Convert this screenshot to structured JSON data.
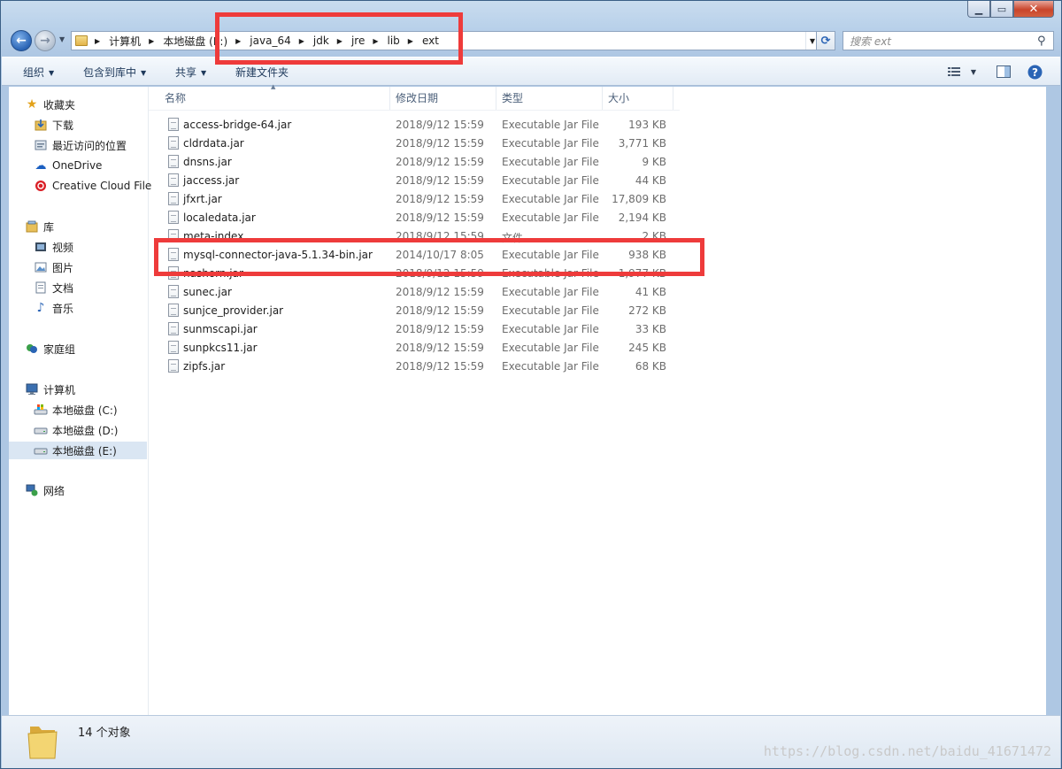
{
  "address": {
    "crumbs": [
      "计算机",
      "本地磁盘 (E:)",
      "java_64",
      "jdk",
      "jre",
      "lib",
      "ext"
    ]
  },
  "search": {
    "placeholder": "搜索 ext"
  },
  "toolbar": {
    "organize": "组织",
    "include_in_library": "包含到库中",
    "share": "共享",
    "new_folder": "新建文件夹"
  },
  "nav": {
    "favorites": "收藏夹",
    "downloads": "下载",
    "recent": "最近访问的位置",
    "onedrive": "OneDrive",
    "creative_cloud": "Creative Cloud File",
    "libraries": "库",
    "videos": "视频",
    "pictures": "图片",
    "documents": "文档",
    "music": "音乐",
    "homegroup": "家庭组",
    "computer": "计算机",
    "drive_c": "本地磁盘 (C:)",
    "drive_d": "本地磁盘 (D:)",
    "drive_e": "本地磁盘 (E:)",
    "network": "网络"
  },
  "columns": {
    "name": "名称",
    "date": "修改日期",
    "type": "类型",
    "size": "大小"
  },
  "files": [
    {
      "name": "access-bridge-64.jar",
      "date": "2018/9/12 15:59",
      "type": "Executable Jar File",
      "size": "193 KB"
    },
    {
      "name": "cldrdata.jar",
      "date": "2018/9/12 15:59",
      "type": "Executable Jar File",
      "size": "3,771 KB"
    },
    {
      "name": "dnsns.jar",
      "date": "2018/9/12 15:59",
      "type": "Executable Jar File",
      "size": "9 KB"
    },
    {
      "name": "jaccess.jar",
      "date": "2018/9/12 15:59",
      "type": "Executable Jar File",
      "size": "44 KB"
    },
    {
      "name": "jfxrt.jar",
      "date": "2018/9/12 15:59",
      "type": "Executable Jar File",
      "size": "17,809 KB"
    },
    {
      "name": "localedata.jar",
      "date": "2018/9/12 15:59",
      "type": "Executable Jar File",
      "size": "2,194 KB"
    },
    {
      "name": "meta-index",
      "date": "2018/9/12 15:59",
      "type": "文件",
      "size": "2 KB"
    },
    {
      "name": "mysql-connector-java-5.1.34-bin.jar",
      "date": "2014/10/17 8:05",
      "type": "Executable Jar File",
      "size": "938 KB"
    },
    {
      "name": "nashorn.jar",
      "date": "2018/9/12 15:59",
      "type": "Executable Jar File",
      "size": "1,977 KB"
    },
    {
      "name": "sunec.jar",
      "date": "2018/9/12 15:59",
      "type": "Executable Jar File",
      "size": "41 KB"
    },
    {
      "name": "sunjce_provider.jar",
      "date": "2018/9/12 15:59",
      "type": "Executable Jar File",
      "size": "272 KB"
    },
    {
      "name": "sunmscapi.jar",
      "date": "2018/9/12 15:59",
      "type": "Executable Jar File",
      "size": "33 KB"
    },
    {
      "name": "sunpkcs11.jar",
      "date": "2018/9/12 15:59",
      "type": "Executable Jar File",
      "size": "245 KB"
    },
    {
      "name": "zipfs.jar",
      "date": "2018/9/12 15:59",
      "type": "Executable Jar File",
      "size": "68 KB"
    }
  ],
  "status": {
    "count": "14 个对象"
  },
  "watermark": "https://blog.csdn.net/baidu_41671472",
  "colors": {
    "annotation_red": "#ee3b3b",
    "selection": "#dae6f3"
  }
}
